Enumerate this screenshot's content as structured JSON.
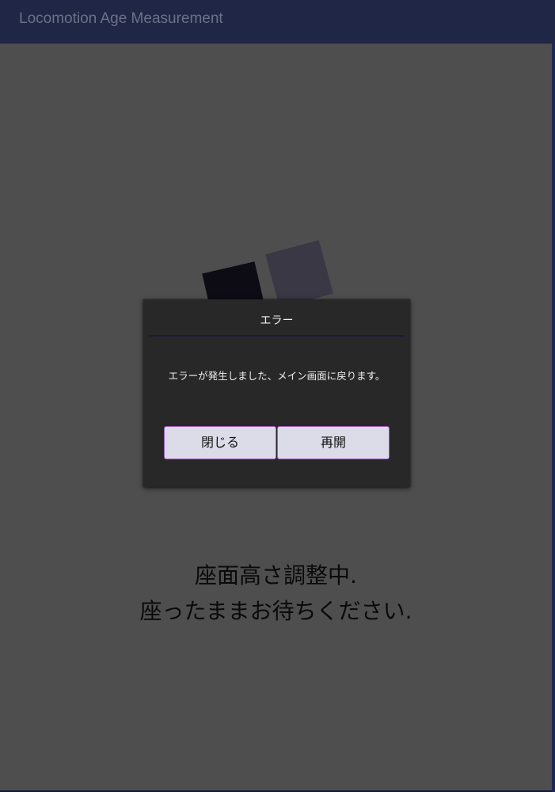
{
  "app_bar": {
    "title": "Locomotion Age Measurement"
  },
  "main": {
    "status_lines": [
      "座面高さ調整中.",
      "座ったままお待ちください."
    ]
  },
  "dialog": {
    "title": "エラー",
    "message": "エラーが発生しました、メイン画面に戻ります。",
    "buttons": {
      "close": "閉じる",
      "resume": "再開"
    }
  },
  "colors": {
    "app_bar": "#202645",
    "content_background": "#4e4e4e",
    "dialog_background": "#282828",
    "button_background": "#dcdbe8",
    "button_border": "#a05cc0"
  }
}
